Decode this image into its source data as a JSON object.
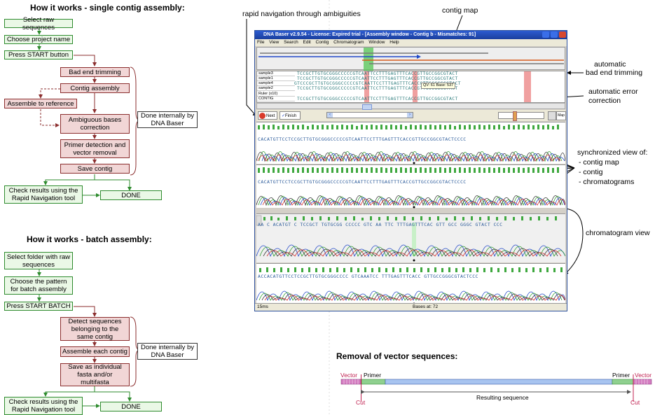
{
  "single": {
    "title": "How it works - single contig assembly:",
    "steps": [
      "Select raw sequences",
      "Choose project name",
      "Press START button"
    ],
    "internal": [
      "Bad end trimming",
      "Contig assembly",
      "Assemble to reference",
      "Ambiguous bases correction",
      "Primer detection and vector removal",
      "Save contig"
    ],
    "done_internally": "Done internally by DNA Baser",
    "check": "Check results using the Rapid Navigation tool",
    "done": "DONE"
  },
  "batch": {
    "title": "How it works - batch assembly:",
    "steps": [
      "Select folder with raw sequences",
      "Choose the pattern for batch assembly",
      "Press START BATCH"
    ],
    "internal": [
      "Detect sequences belonging to the same contig",
      "Assemble each contig",
      "Save as individual fasta and/or multifasta"
    ],
    "done_internally": "Done internally by DNA Baser",
    "check": "Check results using the Rapid Navigation tool",
    "done": "DONE"
  },
  "annotations": {
    "rapid_nav": "rapid navigation through ambiguities",
    "contig_map": "contig map",
    "auto_trim_1": "automatic",
    "auto_trim_2": "bad end trimming",
    "auto_err_1": "automatic error",
    "auto_err_2": "correction",
    "sync_title": "synchronized view of:",
    "sync_1": "- contig map",
    "sync_2": "- contig",
    "sync_3": "- chromatograms",
    "chrom_view": "chromatogram view"
  },
  "window": {
    "title": "DNA Baser v2.9.54  -  License: Expired trial  -  [Assembly window - Contig b  -  Mismatches: 91]",
    "menu": [
      "File",
      "View",
      "Search",
      "Edit",
      "Contig",
      "Chromatogram",
      "Window",
      "Help"
    ],
    "rows": [
      {
        "label": "sample3",
        "seq": "TCCGCTTGTGCGGGCCCCCGTCAATTCCTTTGAGTTTCACCGTTGCCGGCGTACT"
      },
      {
        "label": "sample1",
        "seq": "TCCGCTTGTGCGGGCCCCCGTCAATTCCTTTGAGTTTCACCGTTGCCGGCGTACT"
      },
      {
        "label": "sample4",
        "seq": "GTCCCGCTTGTGCGGGCCCCCGTCAATTCCTTTGAGTTTCACCGTTGCCGGCGTACT"
      },
      {
        "label": "sample2",
        "seq": "TCCGCTTGTGCGGGCCCCCGTCAATTCCTTTGAGTTTCACCGTTGCCGGCGTACT"
      },
      {
        "label": "Ruler (x10)",
        "seq": ""
      },
      {
        "label": "CONTIG",
        "seq": "TCCGCTTGTGCGGGCCCCCGTCAATTCCTTTGAGTTTCACCGTTGCCGGCGTACT"
      }
    ],
    "qv_tip": "QV: 61   Base: 537",
    "next": "Next",
    "finish": "Finish",
    "map_btn": "Map",
    "chrom_bases": [
      "CACATGTTCCTCCGCTTGTGCGGGCCCCCGTCAATTCCTTTGAGTTTCACCGTTGCCGGCGTACTCCCC",
      "CACATGTTCCTCCGCTTGTGCGGGCCCCCGTCAATTCCTTTGAGTTTCACCGTTGCCGGCGTACTCCCC",
      "AA C ACATGT C TCCGCT TGTGCGG CCCCC  GTC AA TTC  TTTGAGTTTCAC  GTT GCC  GGGC GTACT CCC",
      "ACCACATGTTCCTCCGCTTGTGCGGGCCCC GTCAAATCC TTTGAGTTTCACC GTTGCCGGGCGTACTCCC"
    ],
    "status_left": "15ms",
    "status_mid": "Bases at: 72"
  },
  "vector_section": {
    "title": "Removal of vector sequences:",
    "vector_left": "Vector",
    "vector_right": "Vector",
    "primer_left": "Primer",
    "primer_right": "Primer",
    "cut_left": "Cut",
    "cut_right": "Cut",
    "resulting": "Resulting sequence"
  }
}
